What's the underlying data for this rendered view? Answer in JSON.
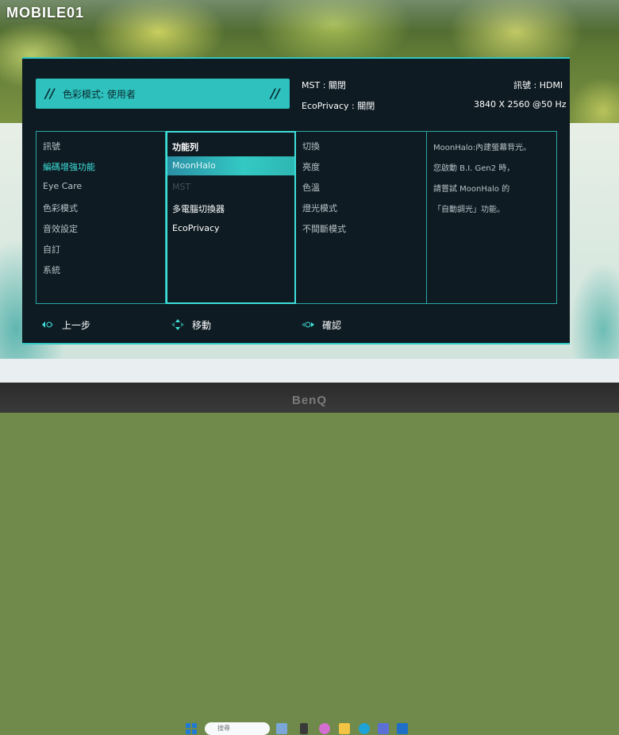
{
  "watermark": "MOBILE01",
  "monitor_brand": "BenQ",
  "osd": {
    "mode_label": "色彩模式: 使用者",
    "mst_label": "MST : 關閉",
    "ecoprivacy_label": "EcoPrivacy : 關閉",
    "input_label": "訊號 : HDMI",
    "resolution_label": "3840 X 2560 @50 Hz",
    "menu": [
      {
        "label": "訊號"
      },
      {
        "label": "編碼增強功能"
      },
      {
        "label": "Eye Care"
      },
      {
        "label": "色彩模式"
      },
      {
        "label": "音效設定"
      },
      {
        "label": "自訂"
      },
      {
        "label": "系統"
      }
    ],
    "submenu": [
      {
        "label": "功能列"
      },
      {
        "label": "MoonHalo"
      },
      {
        "label": "MST"
      },
      {
        "label": "多電腦切換器"
      },
      {
        "label": "EcoPrivacy"
      }
    ],
    "options": [
      {
        "label": "切換"
      },
      {
        "label": "亮度"
      },
      {
        "label": "色溫"
      },
      {
        "label": "燈光模式"
      },
      {
        "label": "不間斷模式"
      }
    ],
    "description": [
      "MoonHalo:內建螢幕背光。",
      "您啟動 B.I. Gen2 時，",
      "請嘗試 MoonHalo 的",
      "「自動調光」功能。"
    ],
    "footer": {
      "back": "上一步",
      "move": "移動",
      "confirm": "確認"
    },
    "accent_color": "#2ec1bd"
  },
  "taskbar": {
    "search_placeholder": "搜尋"
  }
}
